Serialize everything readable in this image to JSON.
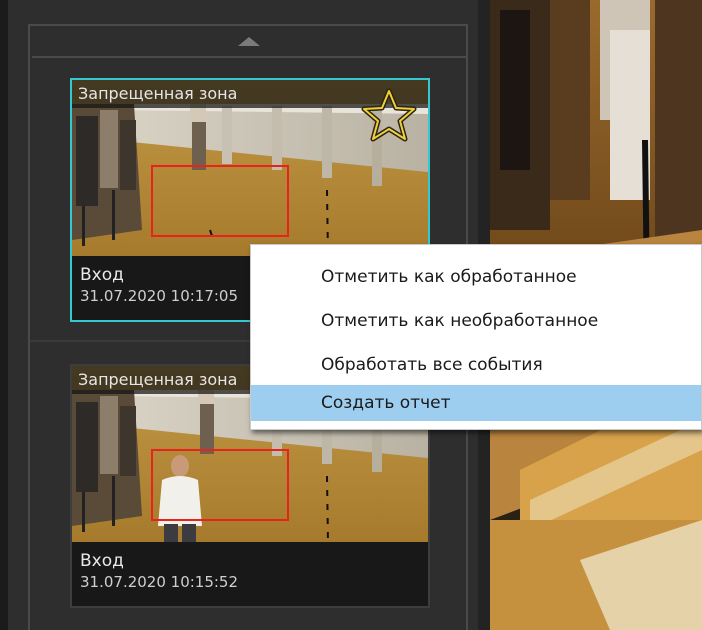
{
  "events": [
    {
      "zone": "Запрещенная зона",
      "camera": "Вход",
      "time": "31.07.2020 10:17:05",
      "selected": true,
      "starred": true
    },
    {
      "zone": "Запрещенная зона",
      "camera": "Вход",
      "time": "31.07.2020 10:15:52",
      "selected": false,
      "starred": false
    }
  ],
  "context_menu": {
    "items": [
      "Отметить как обработанное",
      "Отметить как необработанное",
      "Обработать все события",
      "Создать отчет"
    ],
    "highlighted_index": 3
  },
  "colors": {
    "selection_border": "#36c8d0",
    "detection_box": "#e8231c",
    "star_outline": "#f0d03a",
    "menu_highlight": "#9dcef0"
  },
  "icons": {
    "scroll_up": "triangle-up-icon",
    "favorite": "star-icon"
  }
}
